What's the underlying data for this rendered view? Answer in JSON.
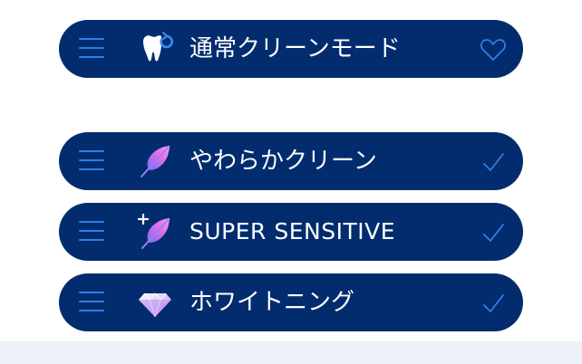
{
  "modes": [
    {
      "label": "通常クリーンモード",
      "icon": "tooth-icon",
      "end_icon": "heart-icon",
      "selected": false
    },
    {
      "label": "やわらかクリーン",
      "icon": "feather-icon",
      "end_icon": "check-icon",
      "selected": true
    },
    {
      "label": "SUPER SENSITIVE",
      "icon": "sparkle-feather-icon",
      "end_icon": "check-icon",
      "selected": true
    },
    {
      "label": "ホワイトニング",
      "icon": "diamond-icon",
      "end_icon": "check-icon",
      "selected": true
    }
  ],
  "colors": {
    "pill_background": "#032c6e",
    "handle": "#2f7fe6",
    "end_icon": "#2f7fe6",
    "bottom_band": "#eef1fa"
  }
}
